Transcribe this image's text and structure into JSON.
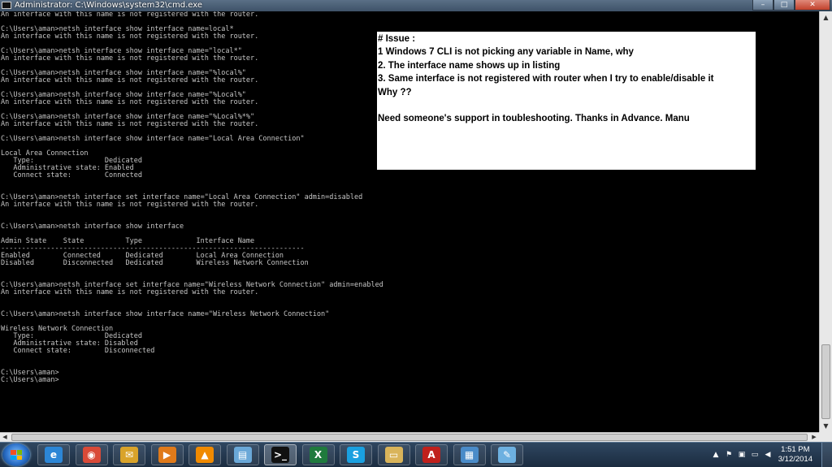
{
  "window": {
    "title": "Administrator: C:\\Windows\\system32\\cmd.exe",
    "minimize": "–",
    "maximize": "□",
    "close": "✕"
  },
  "console_lines": [
    "An interface with this name is not registered with the router.",
    "",
    "C:\\Users\\aman>netsh interface show interface name=local*",
    "An interface with this name is not registered with the router.",
    "",
    "C:\\Users\\aman>netsh interface show interface name=\"local*\"",
    "An interface with this name is not registered with the router.",
    "",
    "C:\\Users\\aman>netsh interface show interface name=\"%local%\"",
    "An interface with this name is not registered with the router.",
    "",
    "C:\\Users\\aman>netsh interface show interface name=\"%Local%\"",
    "An interface with this name is not registered with the router.",
    "",
    "C:\\Users\\aman>netsh interface show interface name=\"%Local%*%\"",
    "An interface with this name is not registered with the router.",
    "",
    "C:\\Users\\aman>netsh interface show interface name=\"Local Area Connection\"",
    "",
    "Local Area Connection",
    "   Type:                 Dedicated",
    "   Administrative state: Enabled",
    "   Connect state:        Connected",
    "",
    "",
    "C:\\Users\\aman>netsh interface set interface name=\"Local Area Connection\" admin=disabled",
    "An interface with this name is not registered with the router.",
    "",
    "",
    "C:\\Users\\aman>netsh interface show interface",
    "",
    "Admin State    State          Type             Interface Name",
    "-------------------------------------------------------------------------",
    "Enabled        Connected      Dedicated        Local Area Connection",
    "Disabled       Disconnected   Dedicated        Wireless Network Connection",
    "",
    "",
    "C:\\Users\\aman>netsh interface set interface name=\"Wireless Network Connection\" admin=enabled",
    "An interface with this name is not registered with the router.",
    "",
    "",
    "C:\\Users\\aman>netsh interface show interface name=\"Wireless Network Connection\"",
    "",
    "Wireless Network Connection",
    "   Type:                 Dedicated",
    "   Administrative state: Disabled",
    "   Connect state:        Disconnected",
    "",
    "",
    "C:\\Users\\aman>",
    "C:\\Users\\aman>"
  ],
  "issue_note": {
    "line1": "# Issue :",
    "line2": "1 Windows 7 CLI is not picking any variable in Name, why",
    "line3": "2. The interface name shows up in listing",
    "line4": "3. Same interface is not registered with router when I try to enable/disable it",
    "line5": "Why ??",
    "line6": "",
    "line7": "Need someone's support in toubleshooting. Thanks in Advance. Manu"
  },
  "taskbar": {
    "apps": [
      {
        "icon": "internet-explorer-icon",
        "glyph": "e",
        "color": "#2c86d6"
      },
      {
        "icon": "chrome-icon",
        "glyph": "◉",
        "color": "#d94a38"
      },
      {
        "icon": "mail-icon",
        "glyph": "✉",
        "color": "#d9a32a"
      },
      {
        "icon": "media-player-icon",
        "glyph": "▶",
        "color": "#e07a1a"
      },
      {
        "icon": "vlc-icon",
        "glyph": "▲",
        "color": "#f08a00"
      },
      {
        "icon": "notes-icon",
        "glyph": "▤",
        "color": "#6aa8d8"
      },
      {
        "icon": "cmd-icon",
        "glyph": ">_",
        "color": "#111111"
      },
      {
        "icon": "excel-icon",
        "glyph": "X",
        "color": "#1f7a3d"
      },
      {
        "icon": "skype-icon",
        "glyph": "S",
        "color": "#1aa0e0"
      },
      {
        "icon": "explorer-folder-icon",
        "glyph": "▭",
        "color": "#d9b45a"
      },
      {
        "icon": "pdf-reader-icon",
        "glyph": "A",
        "color": "#c0201c"
      },
      {
        "icon": "network-icon",
        "glyph": "▦",
        "color": "#4a8bc8"
      },
      {
        "icon": "paint-icon",
        "glyph": "✎",
        "color": "#6db0e0"
      }
    ],
    "clock_time": "1:51 PM",
    "clock_date": "3/12/2014"
  },
  "colors": {
    "console_bg": "#000000",
    "console_fg": "#c6c6c6",
    "note_bg": "#ffffff",
    "taskbar": "#1b2c40"
  }
}
